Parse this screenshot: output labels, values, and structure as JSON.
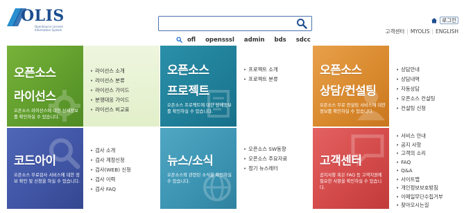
{
  "header": {
    "logo_text": "OLIS",
    "logo_sub": "OpenSource License Information System",
    "search": {
      "value": "",
      "placeholder": ""
    },
    "keywords": [
      "ofl",
      "opensssl",
      "admin",
      "bds",
      "sdcc"
    ],
    "login_label": "로그인",
    "top_links": [
      "고객센터",
      "MYOLIS",
      "ENGLISH"
    ]
  },
  "tiles": [
    {
      "title_line1": "오픈소스",
      "title_line2": "라이선스",
      "desc": "오픈소스 라이선스에 대한 상세정보를 확인하실 수 있습니다.",
      "color": "#6aa834",
      "links": [
        "라이선스 소개",
        "라이선스 분류",
        "라이선스 가이드",
        "분쟁대응 가이드",
        "라이선스 비교표"
      ]
    },
    {
      "title_line1": "오픈소스",
      "title_line2": "프로젝트",
      "desc": "오픈소스 프로젝트에 대한 상세정보를 확인하실 수 있습니다.",
      "color": "#2287a1",
      "links": [
        "프로젝트 소개",
        "프로젝트 분류"
      ]
    },
    {
      "title_line1": "오픈소스",
      "title_line2": "상담/컨설팅",
      "desc": "오픈소스 무료 컨설팅 서비스에 대한 정보를 확인하실 수 있습니다.",
      "color": "#dd8c33",
      "links": [
        "상담안내",
        "상담내역",
        "자동상담",
        "오픈소스 컨설팅",
        "컨설팅 신청"
      ]
    },
    {
      "title_line1": "코드아이",
      "title_line2": "",
      "desc": "오픈소스 무료검사 서비스에 대한 정보 확인 및 신청을 하실 수 있습니다.",
      "color": "#455bab",
      "links": [
        "검사 소개",
        "검사 계정신청",
        "검사(WEB) 신청",
        "검사 이력",
        "검사 FAQ"
      ]
    },
    {
      "title_line1": "뉴스/소식",
      "title_line2": "",
      "desc": "오픈소스와 관련된 소식을 확인하실 수 있습니다.",
      "color": "#3f99b7",
      "links": [
        "오픈소스 SW동향",
        "오픈소스 주요자료",
        "정기 뉴스레터"
      ]
    },
    {
      "title_line1": "고객센터",
      "title_line2": "",
      "desc": "공지사항 혹은 FAQ 등 고객지원에 필요한 사항을 확인하실 수 있습니다.",
      "color": "#d64c4c",
      "links": [
        "서비스 안내",
        "공지 사항",
        "고객의 소리",
        "FAQ",
        "Q&A",
        "사이트맵",
        "개인정보보호방침",
        "이메일무단수집거부",
        "찾아오시는길"
      ]
    }
  ]
}
